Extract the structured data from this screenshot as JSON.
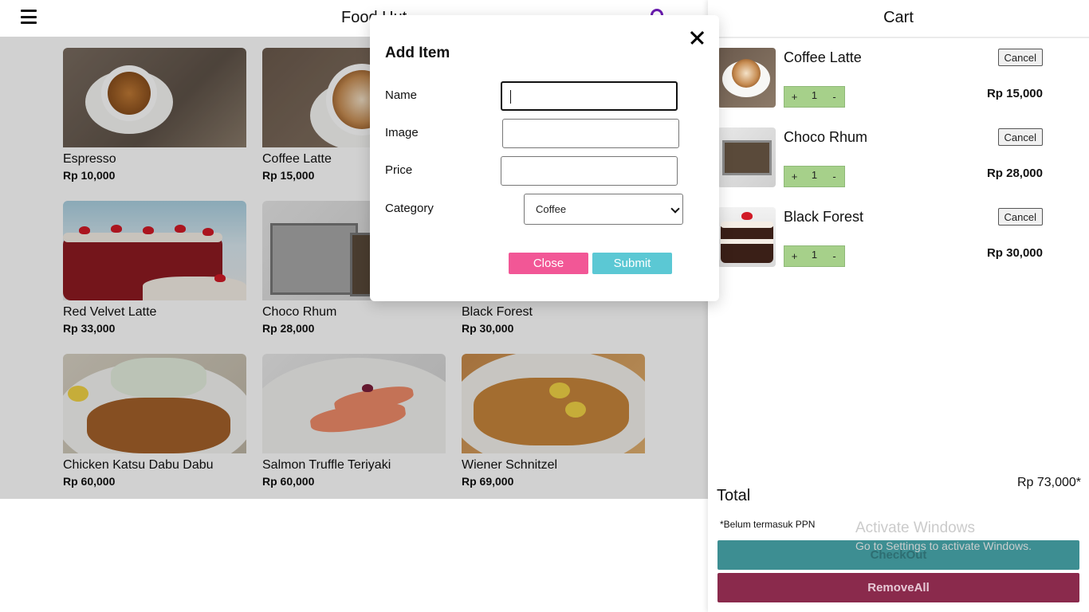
{
  "header": {
    "app_title": "Food Hut",
    "menu_icon": "hamburger-menu-icon",
    "search_icon": "search-icon"
  },
  "menu": {
    "items": [
      {
        "name": "Espresso",
        "price": "Rp 10,000"
      },
      {
        "name": "Coffee Latte",
        "price": "Rp 15,000"
      },
      {
        "name": "Red Velvet Latte",
        "price": "Rp 33,000"
      },
      {
        "name": "Choco Rhum",
        "price": "Rp 28,000"
      },
      {
        "name": "Black Forest",
        "price": "Rp 30,000"
      },
      {
        "name": "Chicken Katsu Dabu Dabu",
        "price": "Rp 60,000"
      },
      {
        "name": "Salmon Truffle Teriyaki",
        "price": "Rp 60,000"
      },
      {
        "name": "Wiener Schnitzel",
        "price": "Rp 69,000"
      }
    ]
  },
  "cart": {
    "title": "Cart",
    "items": [
      {
        "name": "Coffee Latte",
        "cancel_label": "Cancel",
        "plus": "+",
        "qty": "1",
        "minus": "-",
        "price": "Rp 15,000"
      },
      {
        "name": "Choco Rhum",
        "cancel_label": "Cancel",
        "plus": "+",
        "qty": "1",
        "minus": "-",
        "price": "Rp 28,000"
      },
      {
        "name": "Black Forest",
        "cancel_label": "Cancel",
        "plus": "+",
        "qty": "1",
        "minus": "-",
        "price": "Rp 30,000"
      }
    ],
    "total_label": "Total",
    "total_value": "Rp 73,000*",
    "ppn_note": "*Belum termasuk PPN",
    "checkout_label": "CheckOut",
    "removeall_label": "RemoveAll"
  },
  "modal": {
    "title": "Add Item",
    "fields": {
      "name_label": "Name",
      "name_value": "",
      "image_label": "Image",
      "image_value": "",
      "price_label": "Price",
      "price_value": "",
      "category_label": "Category",
      "category_value": "Coffee"
    },
    "close_label": "Close",
    "submit_label": "Submit"
  },
  "watermark": {
    "line1": "Activate Windows",
    "line2": "Go to Settings to activate Windows."
  },
  "colors": {
    "close_button": "#f25796",
    "submit_button": "#5bc8d4",
    "checkout_button": "#3d8e92",
    "removeall_button": "#8a2a4c",
    "stepper": "#a6d08a",
    "search_icon": "#6a1bb0"
  }
}
